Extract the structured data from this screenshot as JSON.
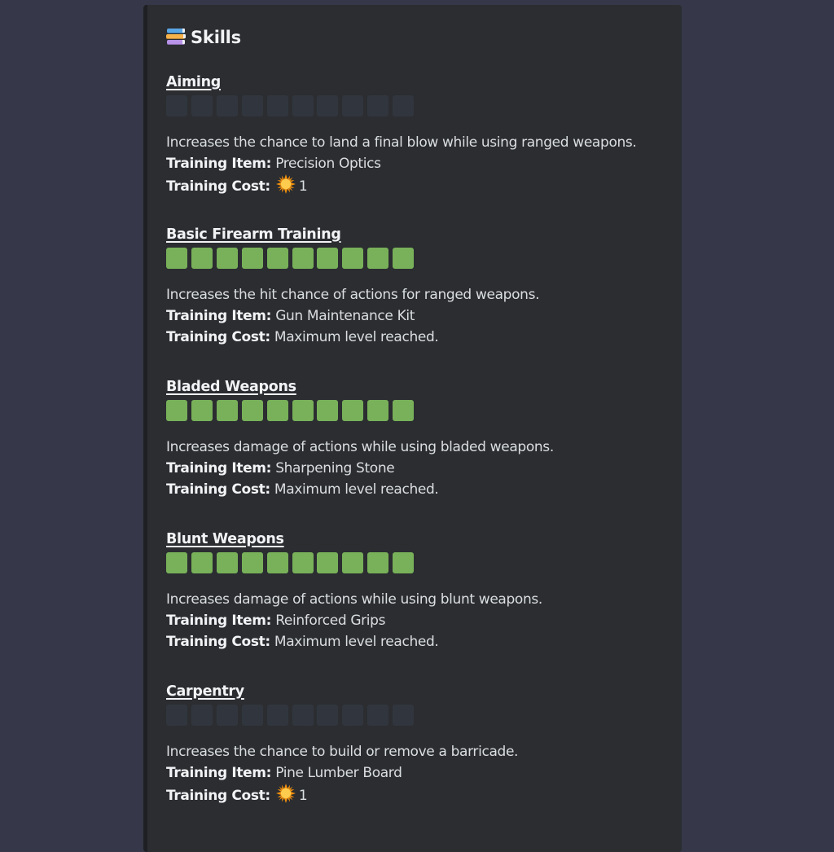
{
  "embed": {
    "title": "Skills",
    "title_icon": "books-icon"
  },
  "labels": {
    "training_item": "Training Item:",
    "training_cost": "Training Cost:"
  },
  "colors": {
    "segment_filled": "#78b159",
    "segment_empty": "#31363e",
    "background": "#363849",
    "embed_background": "#2b2d31"
  },
  "skills": [
    {
      "name": "Aiming",
      "level": 0,
      "max_level": 10,
      "description": "Increases the chance to land a final blow while using ranged weapons.",
      "training_item": "Precision Optics",
      "training_cost": "1",
      "cost_icon": "sun-icon"
    },
    {
      "name": "Basic Firearm Training",
      "level": 10,
      "max_level": 10,
      "description": "Increases the hit chance of actions for ranged weapons.",
      "training_item": "Gun Maintenance Kit",
      "training_cost": "Maximum level reached.",
      "cost_icon": ""
    },
    {
      "name": "Bladed Weapons",
      "level": 10,
      "max_level": 10,
      "description": "Increases damage of actions while using bladed weapons.",
      "training_item": "Sharpening Stone",
      "training_cost": "Maximum level reached.",
      "cost_icon": ""
    },
    {
      "name": "Blunt Weapons",
      "level": 10,
      "max_level": 10,
      "description": "Increases damage of actions while using blunt weapons.",
      "training_item": "Reinforced Grips",
      "training_cost": "Maximum level reached.",
      "cost_icon": ""
    },
    {
      "name": "Carpentry",
      "level": 0,
      "max_level": 10,
      "description": "Increases the chance to build or remove a barricade.",
      "training_item": "Pine Lumber Board",
      "training_cost": "1",
      "cost_icon": "sun-icon"
    }
  ]
}
